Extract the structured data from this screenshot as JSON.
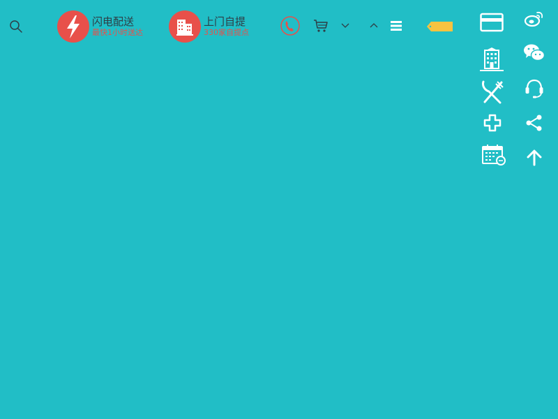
{
  "colors": {
    "background": "#21bec6",
    "accent_red": "#e8504a",
    "dark_text": "#2e3d45",
    "tag_yellow": "#f7c340",
    "icon_white": "#ffffff"
  },
  "header": {
    "search_icon": "search-icon",
    "features": [
      {
        "icon": "lightning-icon",
        "title": "闪电配送",
        "subtitle": "最快1小时送达"
      },
      {
        "icon": "building-icon",
        "title": "上门自提",
        "subtitle": "330家自提点"
      }
    ],
    "actions": [
      {
        "icon": "phone-icon"
      },
      {
        "icon": "cart-icon"
      },
      {
        "icon": "chevron-down-icon"
      },
      {
        "icon": "chevron-up-icon"
      },
      {
        "icon": "menu-icon"
      },
      {
        "icon": "tag-icon"
      }
    ]
  },
  "side_toolbar": {
    "left_column": [
      "card-icon",
      "hotel-icon",
      "restaurant-icon",
      "medical-cross-icon",
      "calendar-icon"
    ],
    "right_column": [
      "weibo-icon",
      "wechat-icon",
      "headset-icon",
      "share-icon",
      "arrow-up-icon"
    ]
  }
}
